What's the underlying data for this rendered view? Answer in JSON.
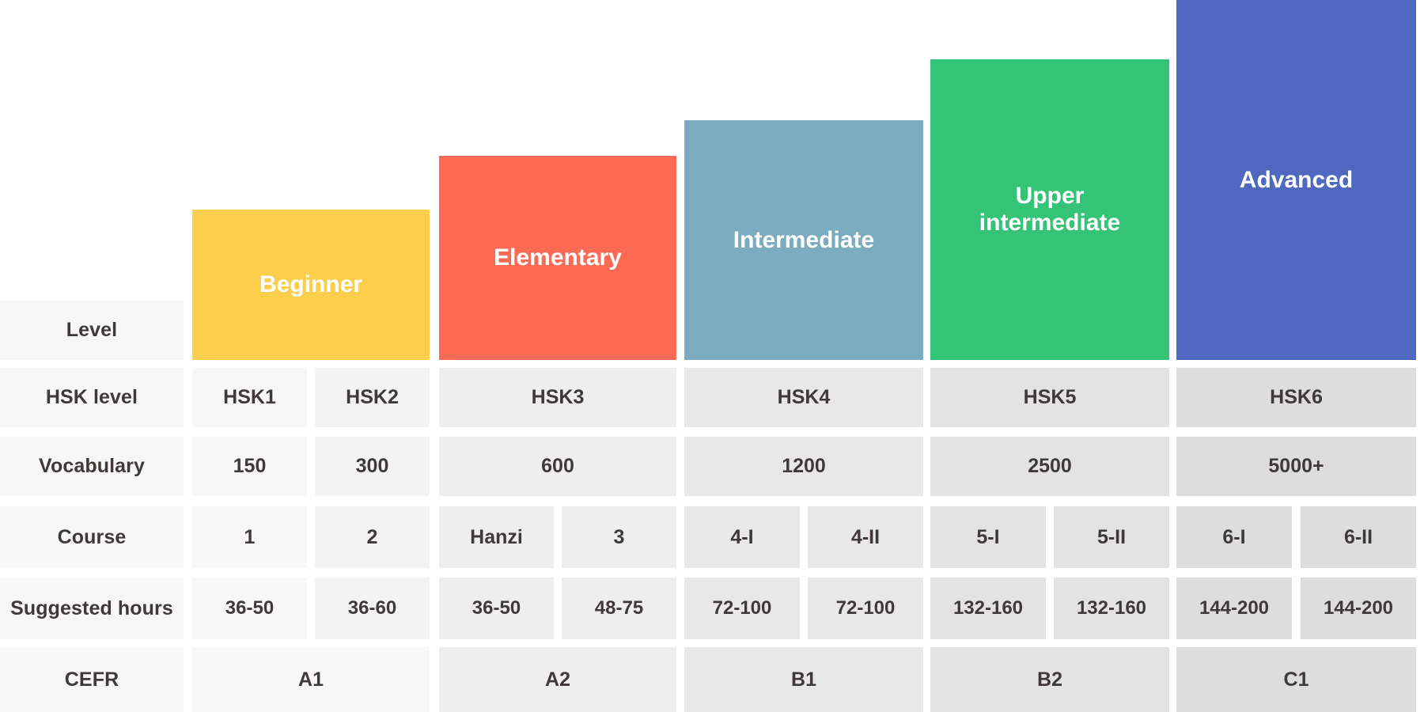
{
  "chart_data": {
    "type": "bar",
    "title": "",
    "xlabel": "",
    "ylabel": "",
    "grid": false,
    "legend": "none",
    "categories": [
      "Beginner",
      "Elementary",
      "Intermediate",
      "Upper intermediate",
      "Advanced"
    ],
    "series": [
      {
        "name": "Vocabulary",
        "values": [
          300,
          600,
          1200,
          2500,
          5000
        ]
      }
    ],
    "annotations": [
      "Bar heights increase left to right, representing progressive HSK levels."
    ]
  },
  "colors": {
    "beginner": "#FBCE4B",
    "elementary": "#FA6A55",
    "intermediate": "#7BACBF",
    "upper_intermediate": "#35C477",
    "advanced": "#5069C0",
    "bar_text": "#ffffff",
    "table_text": "#3f3a39",
    "page_background": "#ffffff"
  },
  "bars": [
    {
      "label": "Beginner",
      "color_key": "beginner",
      "font_size": 30
    },
    {
      "label": "Elementary",
      "color_key": "elementary",
      "font_size": 30
    },
    {
      "label": "Intermediate",
      "color_key": "intermediate",
      "font_size": 30
    },
    {
      "label": "Upper\nintermediate",
      "color_key": "upper_intermediate",
      "font_size": 30
    },
    {
      "label": "Advanced",
      "color_key": "advanced",
      "font_size": 30
    }
  ],
  "table": {
    "row_labels": [
      "Level",
      "HSK level",
      "Vocabulary",
      "Course",
      "Suggested hours",
      "CEFR"
    ],
    "rows": {
      "level": [
        "Beginner",
        "Elementary",
        "Intermediate",
        "Upper intermediate",
        "Advanced"
      ],
      "hsk": [
        "HSK1",
        "HSK2",
        "HSK3",
        "HSK4",
        "HSK5",
        "HSK6"
      ],
      "vocab": [
        "150",
        "300",
        "600",
        "1200",
        "2500",
        "5000+"
      ],
      "course": [
        "1",
        "2",
        "Hanzi",
        "3",
        "4-I",
        "4-II",
        "5-I",
        "5-II",
        "6-I",
        "6-II"
      ],
      "hours": [
        "36-50",
        "36-60",
        "36-50",
        "48-75",
        "72-100",
        "72-100",
        "132-160",
        "132-160",
        "144-200",
        "144-200"
      ],
      "cefr": [
        "A1",
        "A2",
        "B1",
        "B2",
        "C1"
      ]
    }
  }
}
